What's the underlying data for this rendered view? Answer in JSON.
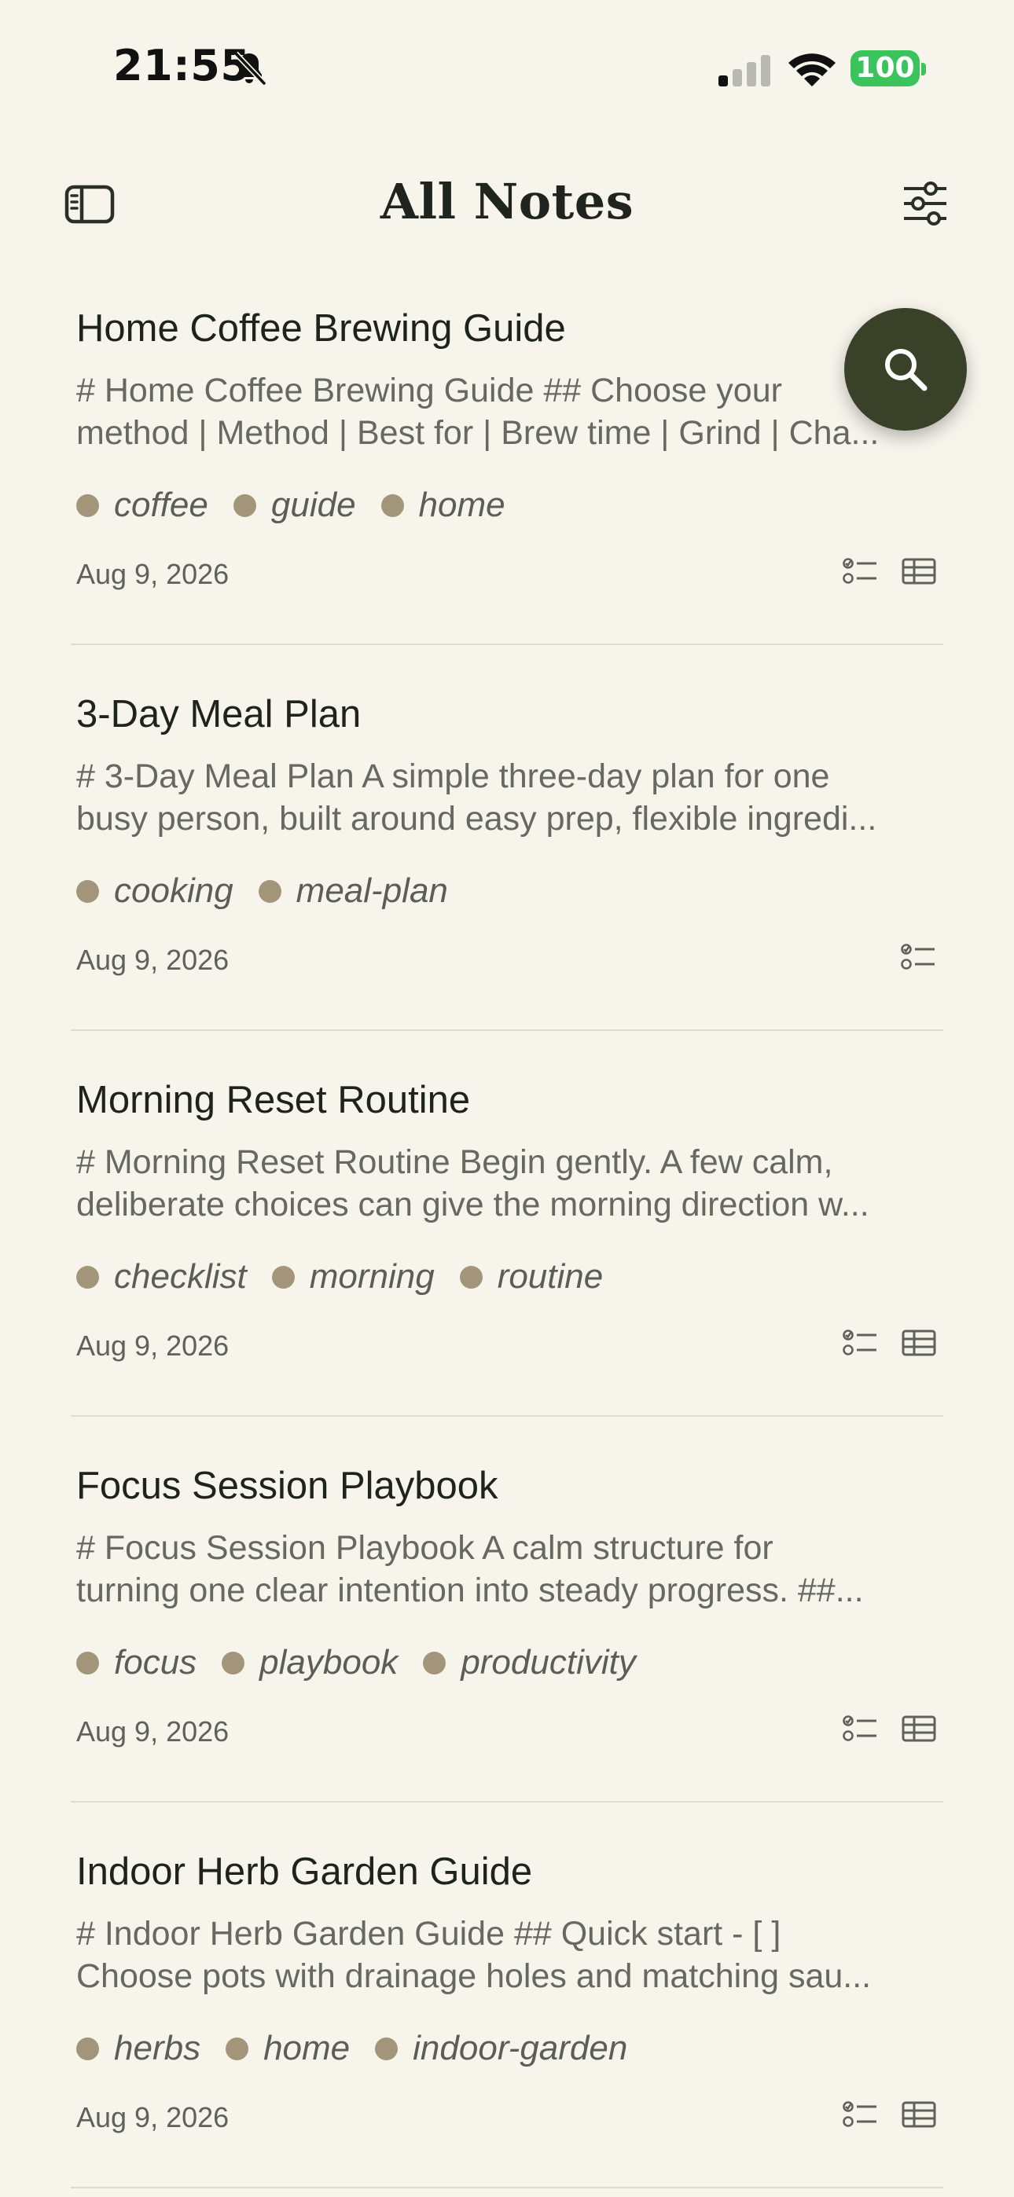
{
  "status_bar": {
    "time": "21:55",
    "battery": "100",
    "icons": [
      "bell-slash-icon",
      "cellular-signal-icon",
      "wifi-icon",
      "battery-icon"
    ]
  },
  "nav": {
    "title": "All Notes",
    "left_icon": "sidebar-icon",
    "right_icon": "sliders-icon"
  },
  "fab": {
    "icon": "search-icon"
  },
  "colors": {
    "background": "#F7F4EC",
    "fab": "#3A4129",
    "tag_dot": "#A3957A",
    "battery": "#3BC45B"
  },
  "notes": [
    {
      "title": "Home Coffee Brewing Guide",
      "preview_line1": "# Home Coffee Brewing Guide  ## Choose your",
      "preview_line2": "method  | Method | Best for | Brew time | Grind | Cha...",
      "tags": [
        "coffee",
        "guide",
        "home"
      ],
      "date": "Aug 9, 2026",
      "has_checklist": true,
      "has_table": true
    },
    {
      "title": "3-Day Meal Plan",
      "preview_line1": "# 3-Day Meal Plan  A simple three-day plan for one",
      "preview_line2": "busy person, built around easy prep, flexible ingredi...",
      "tags": [
        "cooking",
        "meal-plan"
      ],
      "date": "Aug 9, 2026",
      "has_checklist": true,
      "has_table": false
    },
    {
      "title": "Morning Reset Routine",
      "preview_line1": "# Morning Reset Routine  Begin gently. A few calm,",
      "preview_line2": "deliberate choices can give the morning direction w...",
      "tags": [
        "checklist",
        "morning",
        "routine"
      ],
      "date": "Aug 9, 2026",
      "has_checklist": true,
      "has_table": true
    },
    {
      "title": "Focus Session Playbook",
      "preview_line1": "# Focus Session Playbook  A calm structure for",
      "preview_line2": "turning one clear intention into steady progress.  ##...",
      "tags": [
        "focus",
        "playbook",
        "productivity"
      ],
      "date": "Aug 9, 2026",
      "has_checklist": true,
      "has_table": true
    },
    {
      "title": "Indoor Herb Garden Guide",
      "preview_line1": "# Indoor Herb Garden Guide  ## Quick start  - [ ]",
      "preview_line2": "Choose pots with drainage holes and matching sau...",
      "tags": [
        "herbs",
        "home",
        "indoor-garden"
      ],
      "date": "Aug 9, 2026",
      "has_checklist": true,
      "has_table": true
    }
  ]
}
